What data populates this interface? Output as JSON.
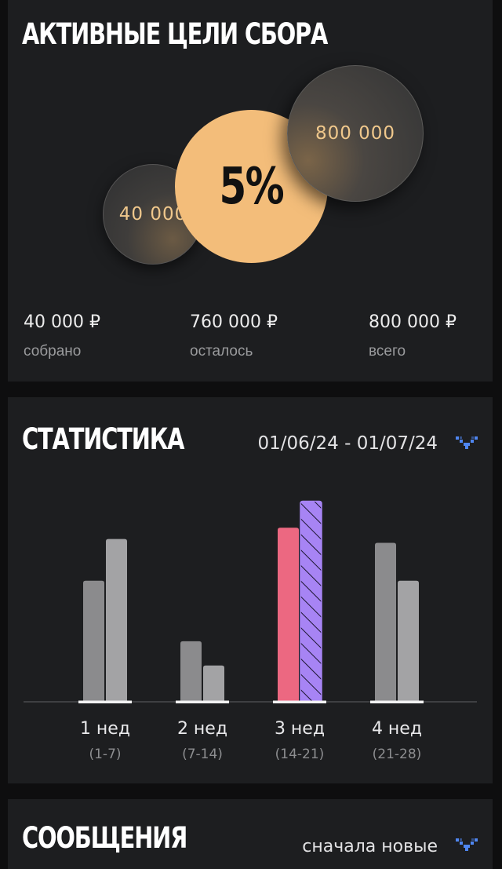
{
  "goals": {
    "title": "АКТИВНЫЕ ЦЕЛИ СБОРА",
    "bubbles": {
      "collected": "40 000",
      "percent": "5%",
      "total": "800 000"
    },
    "progress_percent": 5,
    "summary": [
      {
        "amount": "40 000 ₽",
        "caption": "собрано"
      },
      {
        "amount": "760 000 ₽",
        "caption": "осталось"
      },
      {
        "amount": "800 000 ₽",
        "caption": "всего"
      }
    ],
    "colors": {
      "accent": "#f3bd7a",
      "bubble_text": "#f0c88c"
    }
  },
  "stats": {
    "title": "СТАТИСТИКА",
    "period": "01/06/24 - 01/07/24",
    "dropdown_icon": "chevron-down-icon"
  },
  "chart_data": {
    "type": "bar",
    "categories": [
      "1 нед",
      "2 нед",
      "3 нед",
      "4 нед"
    ],
    "category_ranges": [
      "(1-7)",
      "(7-14)",
      "(14-21)",
      "(21-28)"
    ],
    "series": [
      {
        "values": [
          160,
          80,
          230,
          210
        ]
      },
      {
        "values": [
          215,
          48,
          265,
          160
        ]
      }
    ],
    "ylim": [
      0,
      280
    ],
    "highlight_index": 2,
    "colors": {
      "series_a": "#8b8b8d",
      "series_b": "#a3a3a5",
      "highlight_a": "#ec6881",
      "highlight_b": "#a784f4",
      "baseline": "#4a4a4d",
      "base_segment": "#f2f2f2"
    },
    "grid": false,
    "legend": "none"
  },
  "messages": {
    "title": "СООБЩЕНИЯ",
    "sort_label": "сначала новые",
    "dropdown_icon": "chevron-down-icon"
  }
}
